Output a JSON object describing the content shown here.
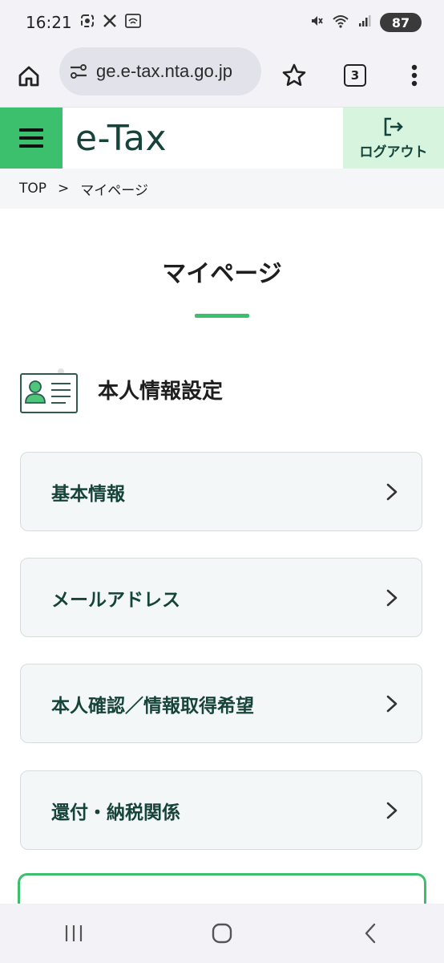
{
  "status_bar": {
    "time": "16:21",
    "battery": "87"
  },
  "browser": {
    "url": "ge.e-tax.nta.go.jp",
    "tab_count": "3"
  },
  "header": {
    "logo": "e-Tax",
    "logout_label": "ログアウト",
    "accent_color": "#3cc06e"
  },
  "breadcrumb": {
    "home": "TOP",
    "separator": ">",
    "current": "マイページ"
  },
  "page": {
    "title": "マイページ"
  },
  "section": {
    "title": "本人情報設定",
    "icon": "id-card-icon"
  },
  "menu": [
    {
      "label": "基本情報"
    },
    {
      "label": "メールアドレス"
    },
    {
      "label": "本人確認／情報取得希望"
    },
    {
      "label": "還付・納税関係"
    }
  ]
}
